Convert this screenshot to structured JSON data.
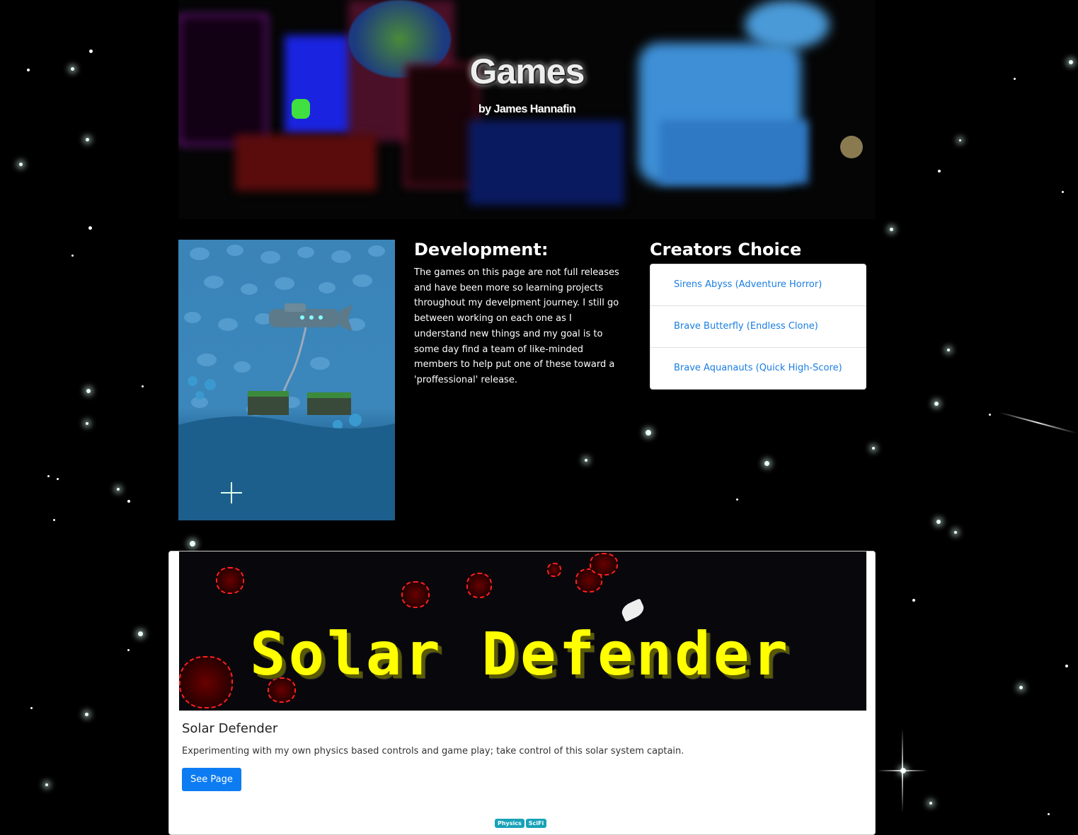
{
  "hero": {
    "title": "Games",
    "subtitle": "by James Hannafin"
  },
  "development": {
    "heading": "Development:",
    "body": "The games on this page are not full releases and have been more so learning projects throughout my develpment journey. I still go between working on each one as I understand new things and my goal is to some day find a team of like-minded members to help put one of these toward a 'proffessional' release."
  },
  "creators_choice": {
    "heading": "Creators Choice",
    "items": [
      {
        "label": "Sirens Abyss (Adventure Horror)"
      },
      {
        "label": "Brave Butterfly (Endless Clone)"
      },
      {
        "label": "Brave Aquanauts (Quick High-Score)"
      }
    ]
  },
  "card": {
    "banner_text": "Solar Defender",
    "title": "Solar Defender",
    "text": "Experimenting with my own physics based controls and game play; take control of this solar system captain.",
    "button_label": "See Page",
    "badges": [
      "Physics",
      "SciFi"
    ]
  },
  "colors": {
    "link": "#1a7ee0",
    "button": "#0d7cf2",
    "badge": "#17a2b8",
    "banner_text": "#ffff00"
  }
}
